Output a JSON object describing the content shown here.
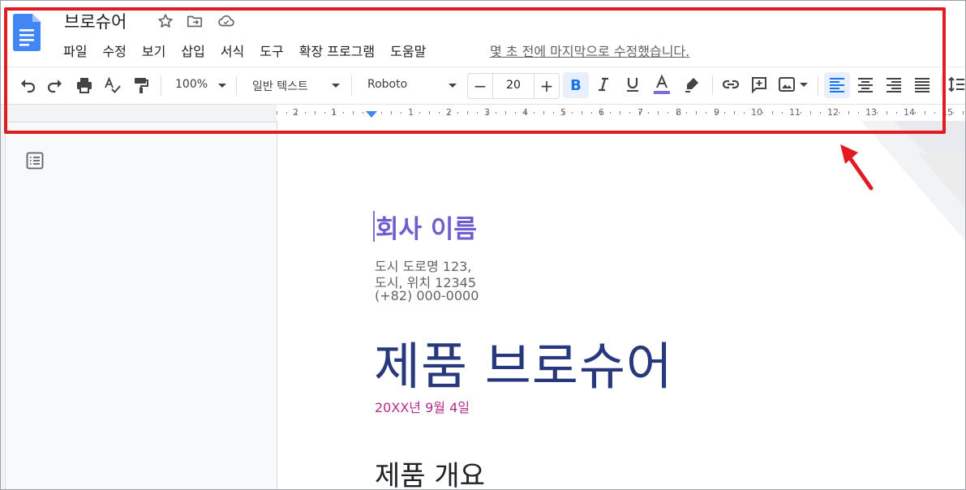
{
  "document": {
    "title": "브로슈어",
    "menu": [
      "파일",
      "수정",
      "보기",
      "삽입",
      "서식",
      "도구",
      "확장 프로그램",
      "도움말"
    ],
    "last_edit": "몇 초 전에 마지막으로 수정했습니다."
  },
  "toolbar": {
    "zoom": "100%",
    "style": "일반 텍스트",
    "font": "Roboto",
    "font_size": "20",
    "minus": "−",
    "plus": "+",
    "bold": "B"
  },
  "ruler": {
    "numbers": [
      "2",
      "1",
      "1",
      "2",
      "3",
      "4",
      "5",
      "6",
      "7",
      "8",
      "9",
      "10",
      "11",
      "12",
      "13",
      "14",
      "15"
    ]
  },
  "page": {
    "company_name": "회사 이름",
    "address": [
      "도시 도로명 123,",
      "도시, 위치 12345",
      "(+82) 000-0000"
    ],
    "main_title": "제품 브로슈어",
    "date": "20XX년 9월 4일",
    "section_heading": "제품 개요"
  },
  "icons": {
    "title": [
      "star-icon",
      "move-to-folder-icon",
      "cloud-saved-icon"
    ],
    "toolbar": [
      "undo-icon",
      "redo-icon",
      "print-icon",
      "spellcheck-icon",
      "paint-format-icon",
      "italic-icon",
      "underline-icon",
      "text-color-icon",
      "highlight-icon",
      "link-icon",
      "add-comment-icon",
      "insert-image-icon",
      "align-left-icon",
      "align-center-icon",
      "align-right-icon",
      "justify-icon",
      "line-spacing-icon"
    ]
  },
  "colors": {
    "annotation": "#e21b23",
    "company": "#6f5ecf",
    "title": "#27397c",
    "date": "#b52b8c",
    "accent": "#1a73e8"
  }
}
